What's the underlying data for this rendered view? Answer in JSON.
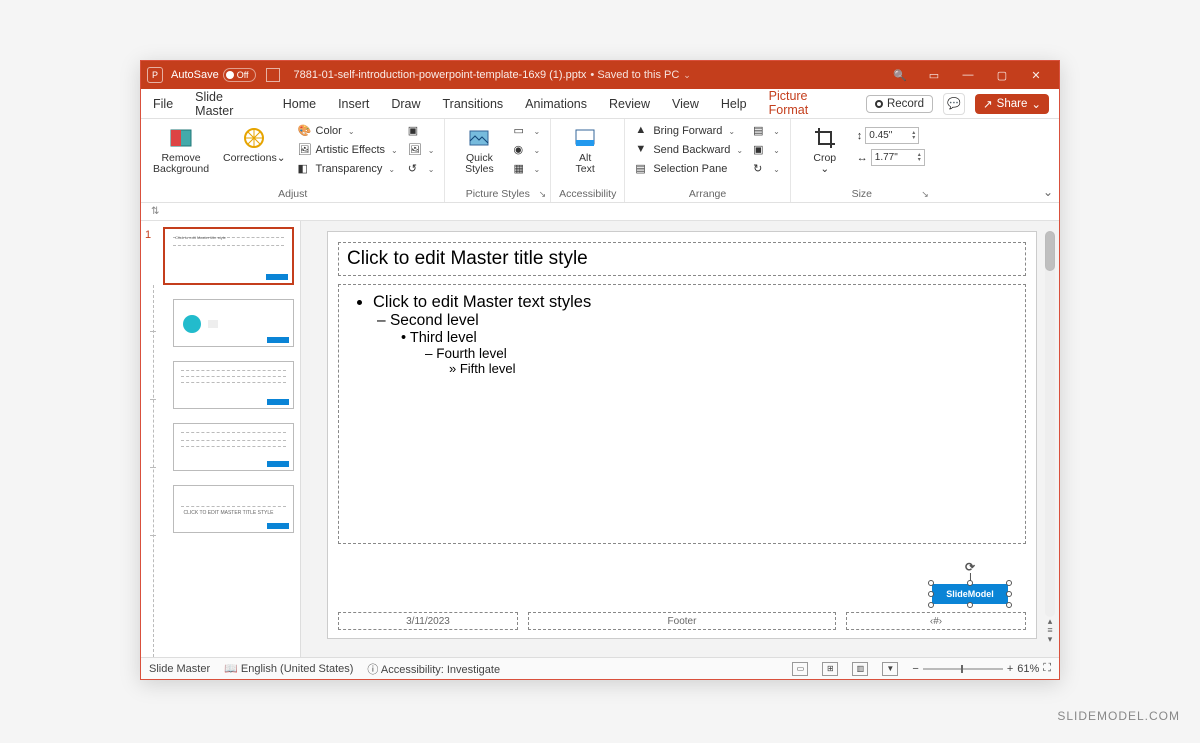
{
  "titlebar": {
    "autosave_label": "AutoSave",
    "autosave_state": "Off",
    "filename": "7881-01-self-introduction-powerpoint-template-16x9 (1).pptx",
    "saved_state": "Saved to this PC"
  },
  "tabs": {
    "items": [
      "File",
      "Slide Master",
      "Home",
      "Insert",
      "Draw",
      "Transitions",
      "Animations",
      "Review",
      "View",
      "Help",
      "Picture Format"
    ],
    "active": "Picture Format",
    "record": "Record",
    "share": "Share"
  },
  "ribbon": {
    "adjust": {
      "label": "Adjust",
      "remove_bg": "Remove\nBackground",
      "corrections": "Corrections",
      "color": "Color",
      "artistic": "Artistic Effects",
      "transparency": "Transparency"
    },
    "picstyles": {
      "label": "Picture Styles",
      "quick": "Quick\nStyles"
    },
    "accessibility": {
      "label": "Accessibility",
      "alt": "Alt\nText"
    },
    "arrange": {
      "label": "Arrange",
      "forward": "Bring Forward",
      "backward": "Send Backward",
      "selpane": "Selection Pane"
    },
    "size": {
      "label": "Size",
      "crop": "Crop",
      "height": "0.45\"",
      "width": "1.77\""
    }
  },
  "slide": {
    "title_placeholder": "Click to edit Master title style",
    "body_l1": "Click to edit Master text styles",
    "body_l2": "Second level",
    "body_l3": "Third level",
    "body_l4": "Fourth level",
    "body_l5": "Fifth level",
    "date": "3/11/2023",
    "footer": "Footer",
    "pagenum": "‹#›",
    "selected_logo": "SlideModel"
  },
  "thumbs": {
    "first_index": "1"
  },
  "status": {
    "view": "Slide Master",
    "language": "English (United States)",
    "accessibility": "Accessibility: Investigate",
    "zoom": "61%"
  },
  "watermark": "SLIDEMODEL.COM"
}
